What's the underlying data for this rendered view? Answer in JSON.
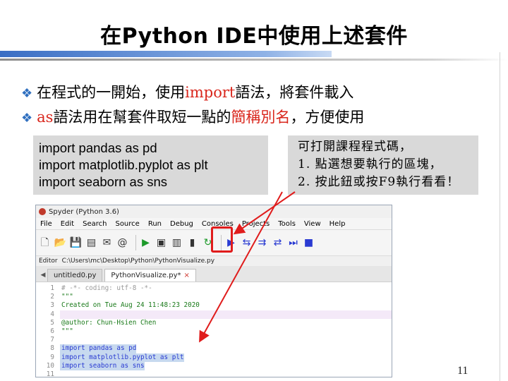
{
  "slide": {
    "title": "在Python  IDE中使用上述套件",
    "page_number": "11",
    "colors": {
      "title_rule": "#3a6ec4",
      "highlight": "#e01c1c",
      "bullet": "#2f6fbf",
      "emphasis": "#d9261c"
    }
  },
  "bullets": [
    {
      "icon": "diamond-bullet-icon",
      "before": "在程式的一開始，使用",
      "highlight": "import",
      "after": "語法，將套件載入"
    },
    {
      "icon": "diamond-bullet-icon",
      "before": "",
      "highlight": "as",
      "middle": "語法用在幫套件取短一點的",
      "highlight2": "簡稱別名",
      "after": "，方便使用"
    }
  ],
  "code_box": {
    "lines": [
      "import pandas as pd",
      "import matplotlib.pyplot as plt",
      "import seaborn as sns"
    ]
  },
  "note_box": {
    "lines": [
      "可打開課程程式碼，",
      "1. 點選想要執行的區塊，",
      "2. 按此鈕或按F9執行看看！"
    ]
  },
  "ide": {
    "window_title": "Spyder (Python 3.6)",
    "menu": [
      "File",
      "Edit",
      "Search",
      "Source",
      "Run",
      "Debug",
      "Consoles",
      "Projects",
      "Tools",
      "View",
      "Help"
    ],
    "editor_label": "Editor",
    "editor_path": "C:\\Users\\mc\\Desktop\\Python\\PythonVisualize.py",
    "tabs": [
      {
        "label": "untitled0.py",
        "active": false
      },
      {
        "label": "PythonVisualize.py*",
        "active": true,
        "close": "×"
      }
    ],
    "toolbar_icons": [
      "new-file-icon",
      "open-folder-icon",
      "save-icon",
      "save-all-icon",
      "email-icon",
      "at-icon",
      "run-icon",
      "run-cell-icon",
      "run-cell-advance-icon",
      "run-selection-icon",
      "rerun-icon",
      "debug-icon",
      "step-icon",
      "step-into-icon",
      "step-return-icon",
      "continue-icon",
      "stop-icon"
    ],
    "code_lines": [
      {
        "n": "1",
        "text": "# -*- coding: utf-8 -*-",
        "kind": "comment"
      },
      {
        "n": "2",
        "text": "\"\"\"",
        "kind": "string"
      },
      {
        "n": "3",
        "text": "Created on Tue Aug 24 11:48:23 2020",
        "kind": "string"
      },
      {
        "n": "4",
        "text": "",
        "kind": "current"
      },
      {
        "n": "5",
        "text": "@author: Chun-Hsien Chen",
        "kind": "string"
      },
      {
        "n": "6",
        "text": "\"\"\"",
        "kind": "string"
      },
      {
        "n": "7",
        "text": "",
        "kind": "plain"
      },
      {
        "n": "8",
        "text": "import pandas as pd",
        "kind": "selected"
      },
      {
        "n": "9",
        "text": "import matplotlib.pyplot as plt",
        "kind": "selected"
      },
      {
        "n": "10",
        "text": "import seaborn as sns",
        "kind": "selected"
      },
      {
        "n": "11",
        "text": "",
        "kind": "plain"
      }
    ]
  }
}
